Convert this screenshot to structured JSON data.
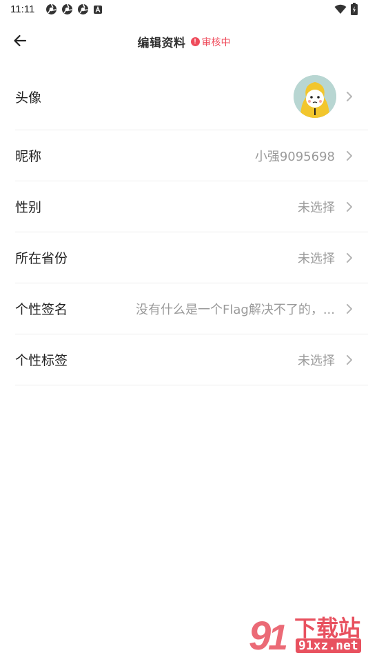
{
  "status_bar": {
    "time": "11:11",
    "icons": [
      "chromium-icon",
      "chromium-icon",
      "chromium-icon",
      "a-notification-icon"
    ],
    "right_icons": [
      "wifi-icon",
      "battery-icon"
    ]
  },
  "header": {
    "back_icon": "arrow-left-icon",
    "title": "编辑资料",
    "review_badge": "审核中",
    "review_icon": "!",
    "accent_color": "#ef4b5b"
  },
  "profile": {
    "rows": [
      {
        "label": "头像",
        "type": "avatar"
      },
      {
        "label": "昵称",
        "value": "小强9095698"
      },
      {
        "label": "性别",
        "value": "未选择"
      },
      {
        "label": "所在省份",
        "value": "未选择"
      },
      {
        "label": "个性签名",
        "value": "没有什么是一个Flag解决不了的，..."
      },
      {
        "label": "个性标签",
        "value": "未选择"
      }
    ]
  },
  "watermark": {
    "logo_text": "下载站",
    "domain": "91xz.net"
  }
}
